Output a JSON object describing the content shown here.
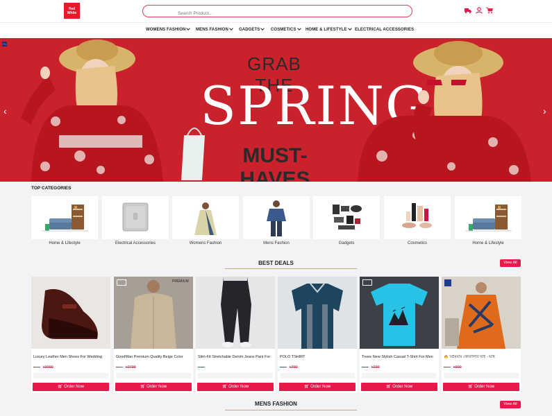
{
  "header": {
    "logo_line1": "Red",
    "logo_line2": "White",
    "search_placeholder": "Search Product...",
    "icons": [
      "truck-icon",
      "user-icon",
      "cart-icon"
    ]
  },
  "nav": {
    "items": [
      {
        "label": "WOMENS FASHION",
        "dropdown": true
      },
      {
        "label": "MENS FASHION",
        "dropdown": true
      },
      {
        "label": "GADGETS",
        "dropdown": true
      },
      {
        "label": "COSMETICS",
        "dropdown": true
      },
      {
        "label": "HOME & LIFESTYLE",
        "dropdown": true
      },
      {
        "label": "ELECTRICAL ACCESSORIES",
        "dropdown": false
      }
    ]
  },
  "banner": {
    "line1": "GRAB THE",
    "line2": "SPRING",
    "line3": "MUST-HAVES",
    "bg_color": "#c9222c"
  },
  "top_categories": {
    "title": "TOP CATEGORIES",
    "items": [
      {
        "label": "Home & Lifestyle"
      },
      {
        "label": "Electrical Accessories"
      },
      {
        "label": "Womens Fashion"
      },
      {
        "label": "Mens Fashion"
      },
      {
        "label": "Gadgets"
      },
      {
        "label": "Cosmetics"
      },
      {
        "label": "Home & Lifestyle"
      }
    ]
  },
  "best_deals": {
    "title": "BEST DEALS",
    "view_all": "View All",
    "products": [
      {
        "name": "Luxury Leather Men Shoes For Wedding",
        "old_price": "৳3000",
        "button": "Order Now"
      },
      {
        "name": "GoodMan Premium Quality Beige Color",
        "old_price": "৳2739",
        "button": "Order Now",
        "tag": "PREMIUM"
      },
      {
        "name": "Slim-Fit Stretchable Denim Jeans Pant For",
        "old_price": "",
        "button": "Order Now"
      },
      {
        "name": "POLO TSHIRT",
        "old_price": "৳790",
        "button": "Order Now"
      },
      {
        "name": "Treee New Stylish Casual T-Shirt For Men",
        "old_price": "৳230",
        "button": "Order Now"
      },
      {
        "name": "🔥 প্রিমিয়াম কোয়ালিটি ছাই - ভাই",
        "old_price": "৳900",
        "button": "Order Now"
      }
    ]
  },
  "mens_fashion": {
    "title": "MENS FASHION",
    "view_all": "View All"
  },
  "colors": {
    "accent": "#e8194a",
    "brand_red": "#e41b2b",
    "gold_line": "#c9a978"
  }
}
